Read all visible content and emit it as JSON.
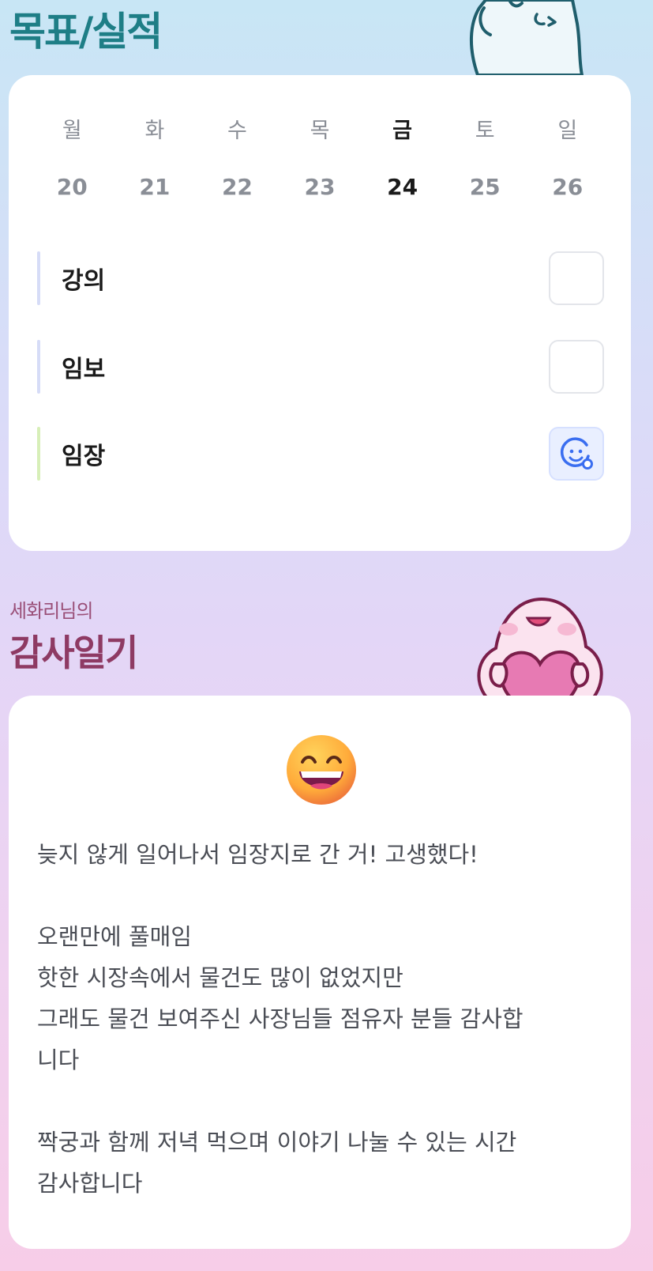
{
  "goal_section": {
    "title": "목표/실적",
    "weekdays": [
      "월",
      "화",
      "수",
      "목",
      "금",
      "토",
      "일"
    ],
    "dates": [
      "20",
      "21",
      "22",
      "23",
      "24",
      "25",
      "26"
    ],
    "today_index": 4,
    "tasks": [
      {
        "label": "강의",
        "done": false,
        "bar_color": "#d6dcf7",
        "check_icon": ""
      },
      {
        "label": "임보",
        "done": false,
        "bar_color": "#d6dcf7",
        "check_icon": ""
      },
      {
        "label": "임장",
        "done": true,
        "bar_color": "#d7efb8",
        "check_icon": "smiley-check-icon"
      }
    ]
  },
  "diary_section": {
    "subtitle": "세화리님의",
    "title": "감사일기",
    "emoji": "grinning-face-emoji",
    "lines": [
      "늦지 않게 일어나서 임장지로 간 거! 고생했다!",
      "",
      "오랜만에 풀매임",
      "핫한 시장속에서 물건도 많이 없었지만",
      "그래도 물건 보여주신 사장님들 점유자 분들 감사합",
      "니다",
      "",
      "짝궁과 함께 저녁 먹으며 이야기 나눌 수 있는 시간",
      "감사합니다"
    ]
  },
  "colors": {
    "goal_title": "#1e7e86",
    "diary_title": "#8e3a63",
    "accent": "#3a6ef0"
  }
}
